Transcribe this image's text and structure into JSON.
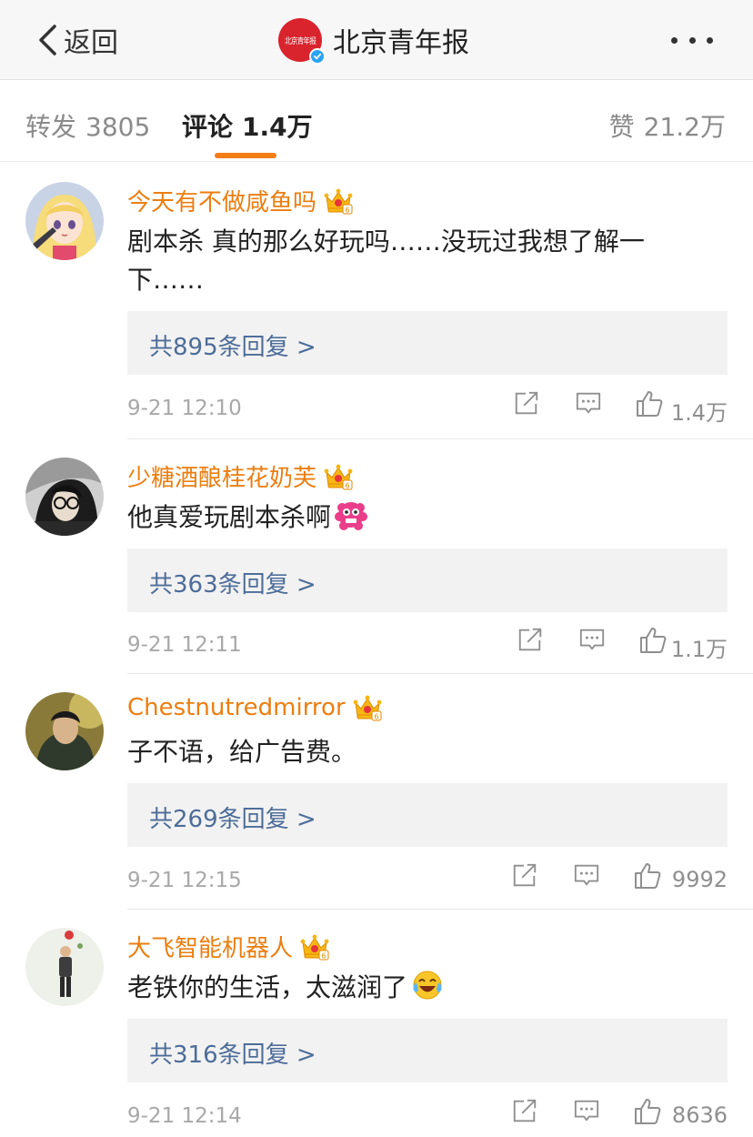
{
  "nav": {
    "back_label": "返回",
    "title": "北京青年报",
    "logo_text": "北京青年报"
  },
  "tabs": {
    "repost_label": "转发",
    "repost_count": "3805",
    "comment_label": "评论",
    "comment_count": "1.4万",
    "like_label": "赞",
    "like_count": "21.2万"
  },
  "colors": {
    "username": "#eb7e10",
    "reply_link": "#4d6d99",
    "tab_indicator": "#f57d16",
    "logo_red": "#d9232d"
  },
  "comments": [
    {
      "username": "今天有不做咸鱼吗",
      "badge_icon": "vip-crown-icon",
      "text": "剧本杀 真的那么好玩吗……没玩过我想了解一下……",
      "replies": "共895条回复 >",
      "time": "9-21 12:10",
      "likes": "1.4万"
    },
    {
      "username": "少糖酒酿桂花奶芙",
      "badge_icon": "vip-crown-icon",
      "text": "他真爱玩剧本杀啊",
      "emoji": "pink-fluffy-emoji",
      "replies": "共363条回复 >",
      "time": "9-21 12:11",
      "likes": "1.1万"
    },
    {
      "username": "Chestnutredmirror",
      "badge_icon": "vip-crown-icon",
      "text": "子不语，给广告费。",
      "replies": "共269条回复 >",
      "time": "9-21 12:15",
      "likes": "9992"
    },
    {
      "username": "大飞智能机器人",
      "badge_icon": "vip-crown-icon",
      "text": "老铁你的生活，太滋润了",
      "emoji": "laughing-tears-emoji",
      "replies": "共316条回复 >",
      "time": "9-21 12:14",
      "likes": "8636"
    }
  ]
}
